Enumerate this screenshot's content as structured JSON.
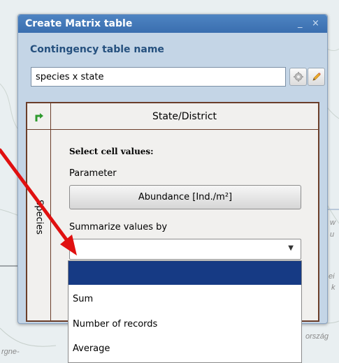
{
  "dialog": {
    "title": "Create Matrix table",
    "minimize_glyph": "_",
    "close_glyph": "×",
    "name_label": "Contingency table name",
    "name_value": "species x state",
    "gear_icon": "gear-icon",
    "edit_icon": "pencil-icon"
  },
  "matrix": {
    "corner_icon": "swap-arrow-icon",
    "column_header": "State/District",
    "row_header": "Species",
    "select_title": "Select cell values:",
    "parameter_label": "Parameter",
    "parameter_value": "Abundance [Ind./m²]",
    "summarize_label": "Summarize values by",
    "summarize_value": ""
  },
  "dropdown": {
    "options": [
      "",
      "Sum",
      "Number of records",
      "Average"
    ],
    "selected_index": 0
  },
  "map": {
    "labels": [
      "rgne-",
      "ország",
      "w",
      "u",
      "ei",
      "k"
    ]
  },
  "colors": {
    "title_bar": "#3a6eaf",
    "matrix_border": "#6b3e2a",
    "selected_option": "#163a84",
    "annotation_arrow": "#e01010"
  }
}
